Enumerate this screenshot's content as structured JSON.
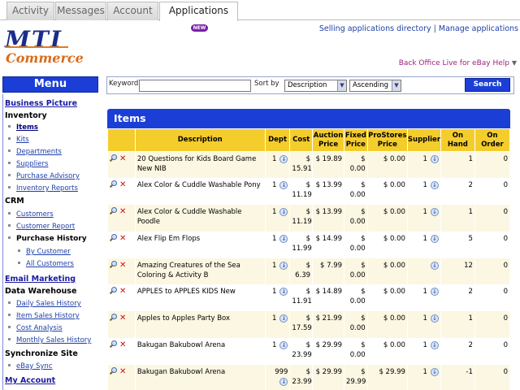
{
  "tabs": [
    {
      "label": "Activity"
    },
    {
      "label": "Messages"
    },
    {
      "label": "Account"
    },
    {
      "label": "Applications",
      "badge": "NEW"
    }
  ],
  "logo": {
    "top": "MTI",
    "bottom": "Commerce"
  },
  "header": {
    "link_directory": "Selling applications directory",
    "separator": "|",
    "link_manage": "Manage applications",
    "help_link": "Back Office Live for eBay Help"
  },
  "menu": {
    "title": "Menu",
    "business_picture": "Business Picture",
    "inventory": "Inventory",
    "items": "Items",
    "kits": "Kits",
    "departments": "Departments",
    "suppliers": "Suppliers",
    "purchase_advisory": "Purchase Advisory",
    "inventory_reports": "Inventory Reports",
    "crm": "CRM",
    "customers": "Customers",
    "customer_report": "Customer Report",
    "purchase_history": "Purchase History",
    "by_customer": "By Customer",
    "all_customers": "All Customers",
    "email_marketing": "Email Marketing",
    "data_warehouse": "Data Warehouse",
    "daily_sales_history": "Daily Sales History",
    "item_sales_history": "Item Sales History",
    "cost_analysis": "Cost Analysis",
    "monthly_sales_history": "Monthly Sales History",
    "synchronize_site": "Synchronize Site",
    "ebay_sync": "eBay Sync",
    "my_account": "My Account"
  },
  "search": {
    "keyword_label": "Keyword",
    "keyword_value": "",
    "sortby_label": "Sort by",
    "sort_field": "Description",
    "sort_order": "Ascending",
    "button": "Search"
  },
  "items_panel": {
    "title": "Items",
    "columns": [
      "",
      "Description",
      "Dept",
      "Cost",
      "Auction Price",
      "Fixed Price",
      "ProStores Price",
      "Supplier",
      "On Hand",
      "On Order"
    ],
    "rows": [
      {
        "description": "20 Questions for Kids Board Game New NIB",
        "dept": "1",
        "cost": "$ 15.91",
        "auction": "$ 19.89",
        "fixed": "$ 0.00",
        "prostores": "$ 0.00",
        "supplier": "1",
        "on_hand": "1",
        "on_order": "0"
      },
      {
        "description": "Alex Color & Cuddle Washable Pony",
        "dept": "1",
        "cost": "$ 11.19",
        "auction": "$ 13.99",
        "fixed": "$ 0.00",
        "prostores": "$ 0.00",
        "supplier": "1",
        "on_hand": "2",
        "on_order": "0"
      },
      {
        "description": "Alex Color & Cuddle Washable Poodle",
        "dept": "1",
        "cost": "$ 11.19",
        "auction": "$ 13.99",
        "fixed": "$ 0.00",
        "prostores": "$ 0.00",
        "supplier": "1",
        "on_hand": "1",
        "on_order": "0"
      },
      {
        "description": "Alex Flip Em Flops",
        "dept": "1",
        "cost": "$ 11.99",
        "auction": "$ 14.99",
        "fixed": "$ 0.00",
        "prostores": "$ 0.00",
        "supplier": "1",
        "on_hand": "5",
        "on_order": "0"
      },
      {
        "description": "Amazing Creatures of the Sea Coloring & Activity B",
        "dept": "1",
        "cost": "$ 6.39",
        "auction": "$ 7.99",
        "fixed": "$ 0.00",
        "prostores": "$ 0.00",
        "supplier": "",
        "on_hand": "12",
        "on_order": "0"
      },
      {
        "description": "APPLES to APPLES KIDS New",
        "dept": "1",
        "cost": "$ 11.91",
        "auction": "$ 14.89",
        "fixed": "$ 0.00",
        "prostores": "$ 0.00",
        "supplier": "1",
        "on_hand": "2",
        "on_order": "0"
      },
      {
        "description": "Apples to Apples Party Box",
        "dept": "1",
        "cost": "$ 17.59",
        "auction": "$ 21.99",
        "fixed": "$ 0.00",
        "prostores": "$ 0.00",
        "supplier": "1",
        "on_hand": "1",
        "on_order": "0"
      },
      {
        "description": "Bakugan Bakubowl Arena",
        "dept": "1",
        "cost": "$ 23.99",
        "auction": "$ 29.99",
        "fixed": "$ 0.00",
        "prostores": "$ 0.00",
        "supplier": "1",
        "on_hand": "2",
        "on_order": "0"
      },
      {
        "description": "Bakugan Bakubowl Arena",
        "dept": "999",
        "cost": "$ 23.99",
        "auction": "$ 29.99",
        "fixed": "$ 29.99",
        "prostores": "$ 29.99",
        "supplier": "1",
        "on_hand": "-1",
        "on_order": "0"
      }
    ]
  }
}
